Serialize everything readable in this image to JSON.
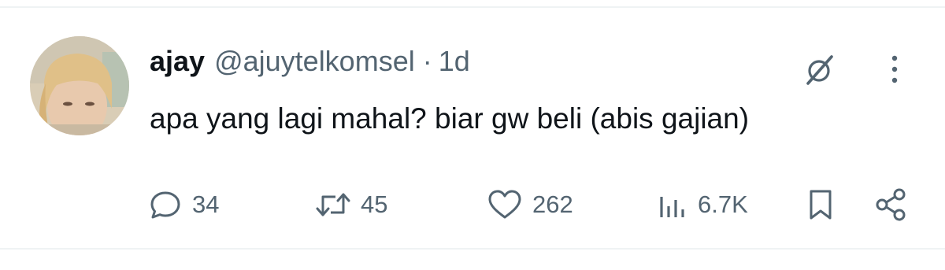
{
  "tweet": {
    "display_name": "ajay",
    "handle": "@ajuytelkomsel",
    "separator": "·",
    "time": "1d",
    "text": "apa yang lagi mahal? biar gw beli (abis gajian)"
  },
  "actions": {
    "replies": "34",
    "reposts": "45",
    "likes": "262",
    "views": "6.7K"
  },
  "icons": {
    "grok": "grok-icon",
    "more": "more-vertical-icon",
    "reply": "reply-icon",
    "repost": "repost-icon",
    "like": "heart-icon",
    "views": "views-bar-chart-icon",
    "bookmark": "bookmark-icon",
    "share": "share-icon"
  },
  "colors": {
    "text_primary": "#0f1419",
    "text_secondary": "#536471",
    "divider": "#eff3f4"
  }
}
